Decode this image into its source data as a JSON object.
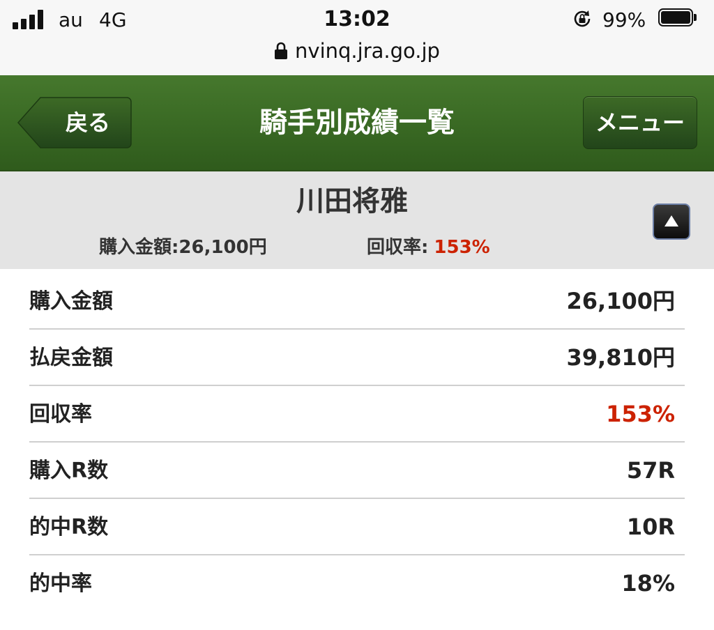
{
  "status_bar": {
    "carrier": "au",
    "network": "4G",
    "time": "13:02",
    "battery": "99%",
    "url": "nvinq.jra.go.jp"
  },
  "header": {
    "back_label": "戻る",
    "title": "騎手別成績一覧",
    "menu_label": "メニュー"
  },
  "summary": {
    "jockey_name": "川田将雅",
    "purchase_text": "購入金額:26,100円",
    "return_rate_label": "回収率:",
    "return_rate_value": "153%"
  },
  "stats": [
    {
      "label": "購入金額",
      "value": "26,100円",
      "highlight": false
    },
    {
      "label": "払戻金額",
      "value": "39,810円",
      "highlight": false
    },
    {
      "label": "回収率",
      "value": "153%",
      "highlight": true
    },
    {
      "label": "購入R数",
      "value": "57R",
      "highlight": false
    },
    {
      "label": "的中R数",
      "value": "10R",
      "highlight": false
    },
    {
      "label": "的中率",
      "value": "18%",
      "highlight": false
    }
  ],
  "colors": {
    "header_green": "#3a6a24",
    "highlight_red": "#cc2200",
    "summary_bg": "#e4e4e4"
  },
  "icons": {
    "signal": "signal-bars-icon",
    "orientation_lock": "rotation-lock-icon",
    "battery": "battery-icon",
    "secure": "lock-icon",
    "collapse": "triangle-up-icon"
  }
}
